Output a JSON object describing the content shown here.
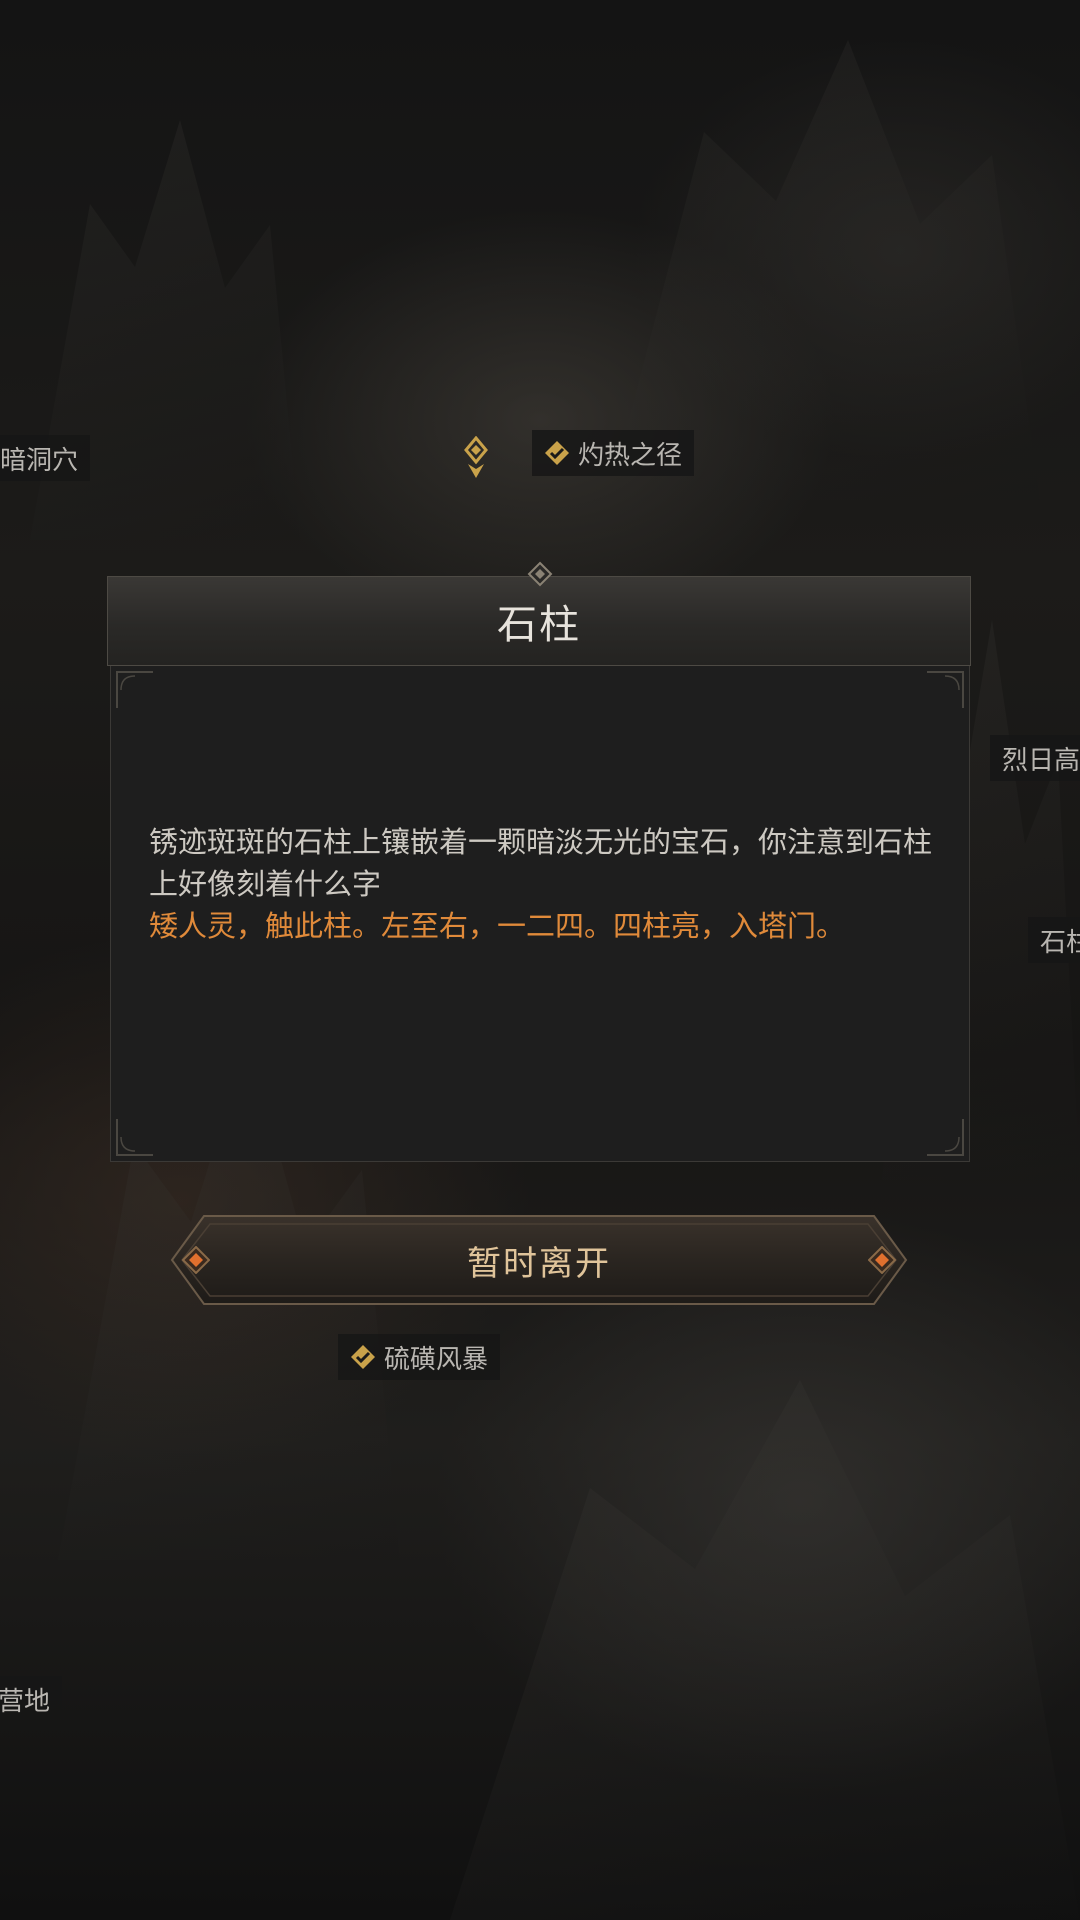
{
  "map": {
    "nodes": [
      {
        "label": "暗洞穴",
        "checked": false
      },
      {
        "label": "灼热之径",
        "checked": true
      },
      {
        "label": "烈日高",
        "checked": false
      },
      {
        "label": "石柱",
        "checked": false
      },
      {
        "label": "硫磺风暴",
        "checked": true
      },
      {
        "label": "营地",
        "checked": false
      }
    ]
  },
  "dialog": {
    "title": "石柱",
    "description": "锈迹斑斑的石柱上镶嵌着一颗暗淡无光的宝石，你注意到石柱上好像刻着什么字",
    "hint": "矮人灵，触此柱。左至右，一二四。四柱亮，入塔门。"
  },
  "button": {
    "leave_label": "暂时离开"
  },
  "colors": {
    "hint_text": "#e08a3a",
    "check_icon": "#c9a24a",
    "button_text": "#e0c49a",
    "button_gem": "#e0702e"
  }
}
